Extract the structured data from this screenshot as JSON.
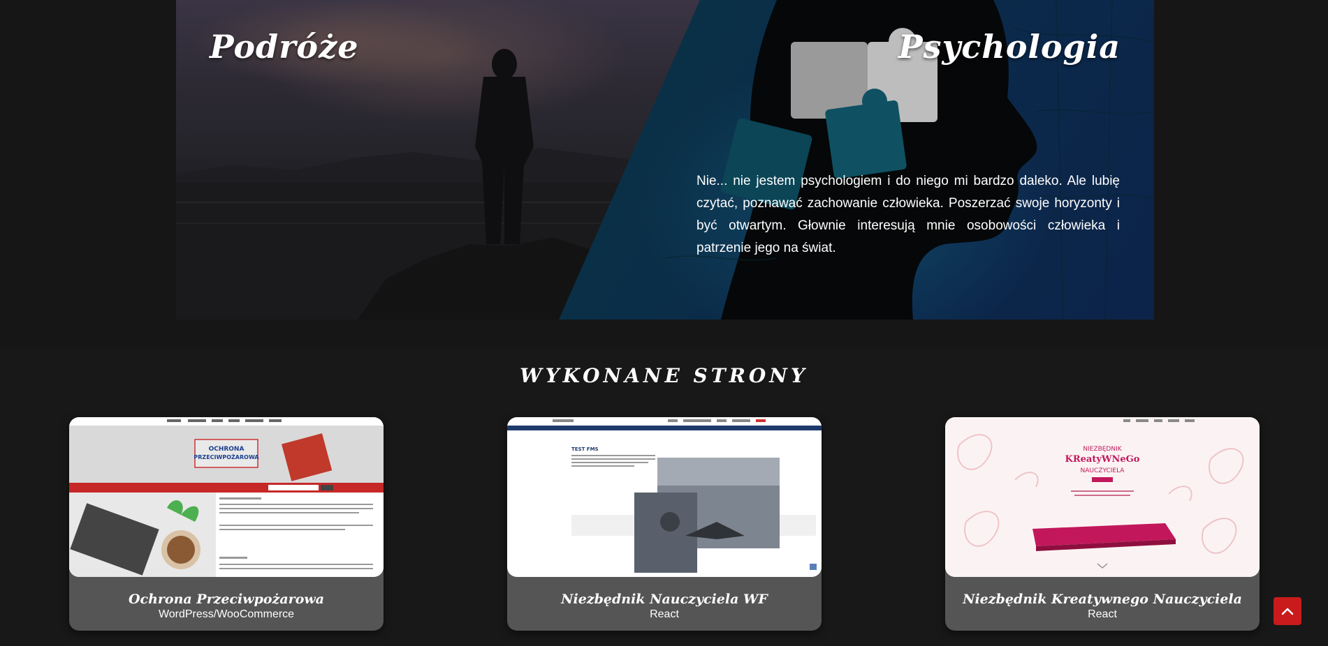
{
  "hero": {
    "left_title": "Podróże",
    "right_title": "Psychologia",
    "right_text": "Nie... nie jestem psychologiem i do niego mi bardzo daleko. Ale lubię czytać, poznawać zachowanie człowieka. Poszerzać swoje horyzonty i być otwartym. Głownie interesują mnie osobowości człowieka i patrzenie jego na świat."
  },
  "projects": {
    "title": "WYKONANE STRONY",
    "cards": [
      {
        "title": "Ochrona Przeciwpożarowa",
        "tech": "WordPress/WooCommerce",
        "thumb_logo_line1": "OCHRONA",
        "thumb_logo_line2": "PRZECIWPOŻAROWA"
      },
      {
        "title": "Niezbędnik Nauczyciela WF",
        "tech": "React",
        "thumb_heading": "TEST FMS"
      },
      {
        "title": "Niezbędnik Kreatywnego Nauczyciela",
        "tech": "React",
        "thumb_line1": "NIEZBĘDNIK",
        "thumb_line2": "KReatyWNeGo",
        "thumb_line3": "NAUCZYCIELA"
      }
    ]
  },
  "colors": {
    "accent_red": "#c91b1b",
    "card_bg": "#555555",
    "page_bg": "#161616"
  },
  "icons": {
    "scroll_top": "chevron-up-icon"
  }
}
